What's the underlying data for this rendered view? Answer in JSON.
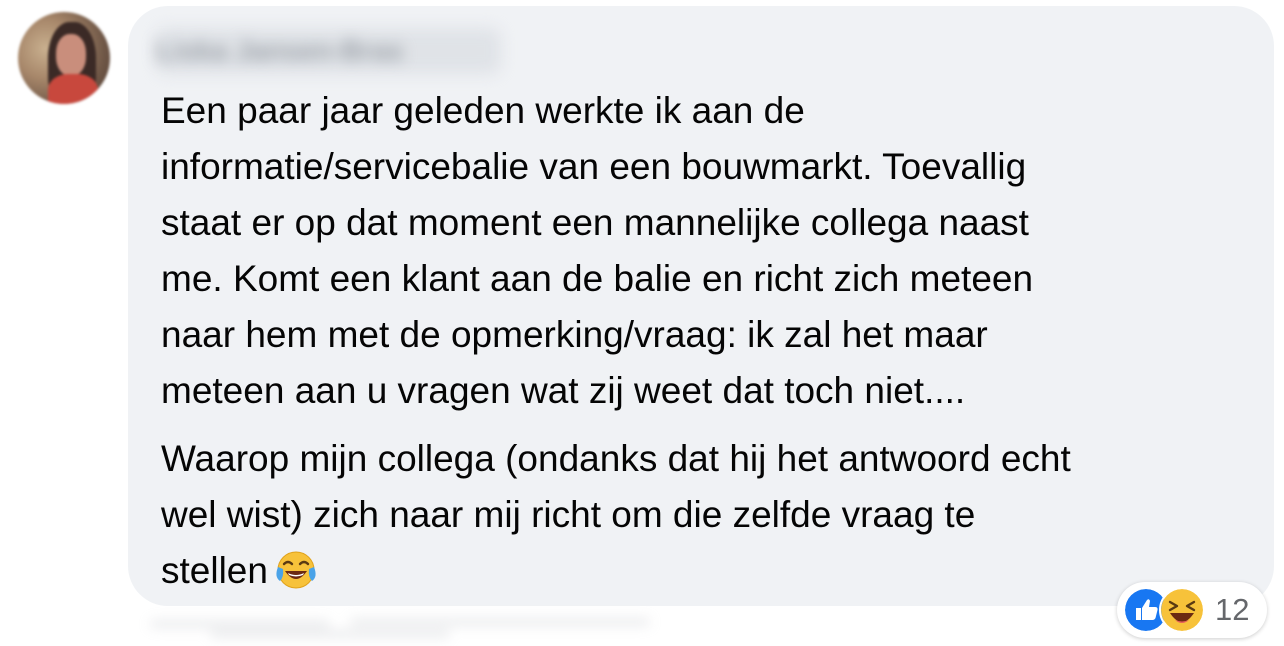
{
  "comment": {
    "author": "Liska Jansen-Bras",
    "paragraphs": [
      {
        "lines": [
          "Een paar jaar geleden werkte ik aan de",
          "informatie/servicebalie van een bouwmarkt. Toevallig",
          "staat er op dat moment een mannelijke collega naast",
          "me. Komt een klant aan de balie en richt zich meteen",
          "naar hem met de opmerking/vraag: ik zal het maar",
          "meteen aan u vragen wat zij weet dat toch niet...."
        ]
      },
      {
        "lines": [
          "Waarop mijn collega (ondanks dat hij het antwoord echt",
          "wel wist) zich naar mij richt om die zelfde vraag te",
          "stellen"
        ],
        "trailing_emoji": "face-with-tears-of-joy-icon"
      }
    ],
    "reactions": {
      "types": [
        "like-icon",
        "haha-icon"
      ],
      "count": "12"
    }
  },
  "colors": {
    "bubble_bg": "#f0f2f5",
    "text": "#050505",
    "like_blue": "#1877f2",
    "muted": "#65676b"
  }
}
